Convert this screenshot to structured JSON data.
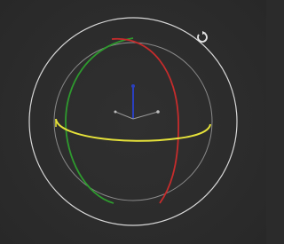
{
  "viewport": {
    "background": "#2b2b2b"
  },
  "gizmo": {
    "type": "rotate-gizmo",
    "colors": {
      "screen_ring": "#d8d8d8",
      "trackball_ring": "#8a8a8a",
      "x_axis": "#c62c2c",
      "y_axis": "#2e9a2e",
      "z_axis": "#e6e23a",
      "z_axis_vector": "#2a3fbf",
      "center_axes": "#9a9a9a"
    }
  },
  "icons": {
    "reset": "rotate-reset-icon"
  }
}
